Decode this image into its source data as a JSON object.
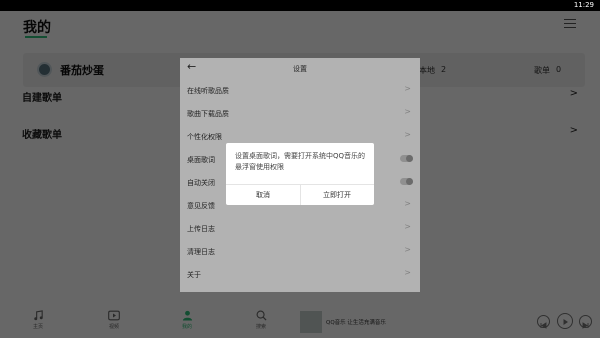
{
  "status_bar": {
    "time": "11:29"
  },
  "header": {
    "title": "我的"
  },
  "profile": {
    "name": "番茄炒蛋",
    "local_label": "本地",
    "local_count": "2",
    "playlist_label": "歌单",
    "playlist_count": "0"
  },
  "sections": {
    "created_playlists": "自建歌单",
    "collected_playlists": "收藏歌单"
  },
  "settings": {
    "title": "设置",
    "items": [
      {
        "label": "在线听歌品质",
        "control": "chevron"
      },
      {
        "label": "歌曲下载品质",
        "control": "chevron"
      },
      {
        "label": "个性化权限",
        "control": "chevron"
      },
      {
        "label": "桌面歌词",
        "control": "toggle"
      },
      {
        "label": "自动关闭",
        "control": "toggle"
      },
      {
        "label": "意见反馈",
        "control": "chevron"
      },
      {
        "label": "上传日志",
        "control": "chevron"
      },
      {
        "label": "清理日志",
        "control": "chevron"
      },
      {
        "label": "关于",
        "control": "chevron"
      }
    ]
  },
  "dialog": {
    "message": "设置桌面歌词，需要打开系统中QQ音乐的悬浮窗使用权限",
    "cancel_label": "取消",
    "confirm_label": "立即打开"
  },
  "bottom_nav": {
    "items": [
      {
        "label": "主页",
        "icon": "music-note-icon"
      },
      {
        "label": "视频",
        "icon": "video-icon"
      },
      {
        "label": "我的",
        "icon": "person-icon",
        "active": true
      },
      {
        "label": "搜索",
        "icon": "search-icon"
      }
    ]
  },
  "player": {
    "now_playing": "QQ音乐 让生活充满音乐"
  },
  "colors": {
    "accent": "#31c27c",
    "overlay": "#000000",
    "card_bg": "#f2f2f2"
  }
}
